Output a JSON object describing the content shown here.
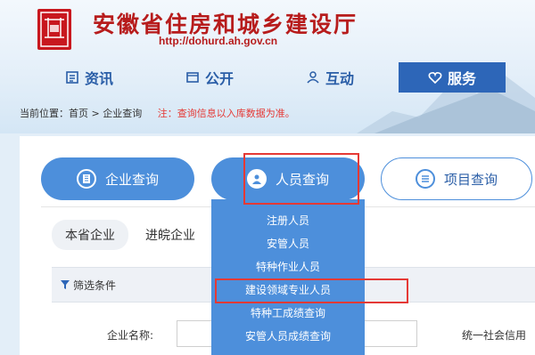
{
  "site": {
    "title": "安徽省住房和城乡建设厅",
    "url": "http://dohurd.ah.gov.cn"
  },
  "nav": [
    {
      "label": "资讯",
      "icon": "news-icon"
    },
    {
      "label": "公开",
      "icon": "open-icon"
    },
    {
      "label": "互动",
      "icon": "interact-icon"
    },
    {
      "label": "服务",
      "icon": "heart-icon",
      "active": true
    }
  ],
  "breadcrumb": {
    "path": "当前位置：首页 > 企业查询",
    "note": "注：查询信息以入库数据为准。"
  },
  "query_buttons": [
    {
      "label": "企业查询",
      "icon": "building-icon"
    },
    {
      "label": "人员查询",
      "icon": "person-icon",
      "highlighted": true
    },
    {
      "label": "项目查询",
      "icon": "list-icon"
    }
  ],
  "dropdown": [
    "注册人员",
    "安管人员",
    "特种作业人员",
    "建设领域专业人员",
    "特种工成绩查询",
    "安管人员成绩查询"
  ],
  "tabs": [
    {
      "label": "本省企业",
      "active": true
    },
    {
      "label": "进皖企业"
    }
  ],
  "filter": {
    "title": "筛选条件"
  },
  "form": {
    "company_name_label": "企业名称:",
    "company_name_value": "",
    "credit_code_label": "统一社会信用"
  },
  "colors": {
    "brand_red": "#b71c1c",
    "accent_blue": "#4d8fdb",
    "nav_active": "#2d66b8",
    "highlight_red": "#e53935"
  }
}
